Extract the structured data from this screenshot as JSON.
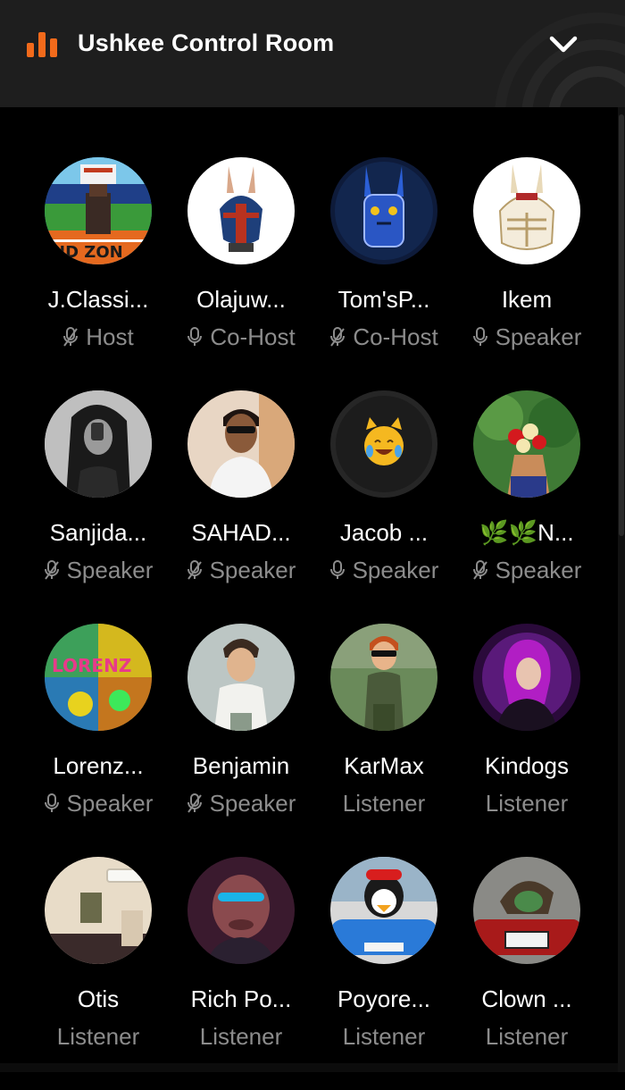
{
  "header": {
    "title": "Ushkee Control Room",
    "accent_color": "#f26a1b",
    "icon": "bar-chart-icon",
    "collapse_icon": "chevron-down-icon"
  },
  "participants": [
    {
      "name": "J.Classi...",
      "role": "Host",
      "mic": "muted"
    },
    {
      "name": "Olajuw...",
      "role": "Co-Host",
      "mic": "on"
    },
    {
      "name": "Tom'sP...",
      "role": "Co-Host",
      "mic": "muted"
    },
    {
      "name": "Ikem",
      "role": "Speaker",
      "mic": "on"
    },
    {
      "name": "Sanjida...",
      "role": "Speaker",
      "mic": "muted"
    },
    {
      "name": "SAHAD...",
      "role": "Speaker",
      "mic": "muted"
    },
    {
      "name": "Jacob ...",
      "role": "Speaker",
      "mic": "on"
    },
    {
      "name": "🌿🌿N...",
      "role": "Speaker",
      "mic": "muted"
    },
    {
      "name": "Lorenz...",
      "role": "Speaker",
      "mic": "on"
    },
    {
      "name": "Benjamin",
      "role": "Speaker",
      "mic": "muted"
    },
    {
      "name": "KarMax",
      "role": "Listener",
      "mic": "none"
    },
    {
      "name": "Kindogs",
      "role": "Listener",
      "mic": "none"
    },
    {
      "name": "Otis",
      "role": "Listener",
      "mic": "none"
    },
    {
      "name": "Rich Po...",
      "role": "Listener",
      "mic": "none"
    },
    {
      "name": "Poyore...",
      "role": "Listener",
      "mic": "none"
    },
    {
      "name": "Clown ...",
      "role": "Listener",
      "mic": "none"
    }
  ]
}
